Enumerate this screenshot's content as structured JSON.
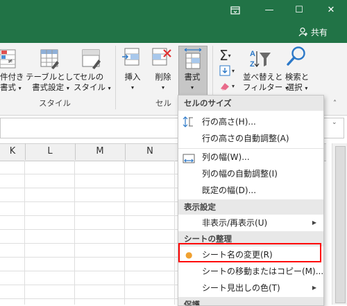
{
  "titlebar": {
    "minimize": "—",
    "maximize": "☐",
    "close": "✕",
    "share_label": "共有",
    "color": "#217346"
  },
  "ribbon": {
    "styles_group": {
      "cond_format_line1": "件付き",
      "cond_format_line2": "書式",
      "table_format_line1": "テーブルとして",
      "table_format_line2": "書式設定",
      "cell_style_line1": "セルの",
      "cell_style_line2": "スタイル",
      "group_label": "スタイル"
    },
    "cells_group": {
      "insert_label": "挿入",
      "delete_label": "削除",
      "format_label": "書式",
      "group_label": "セル"
    },
    "editing_group": {
      "sort_line1": "並べ替えと",
      "sort_line2": "フィルター",
      "find_line1": "検索と",
      "find_line2": "選択"
    }
  },
  "sheet": {
    "columns": [
      "K",
      "L",
      "M",
      "N"
    ]
  },
  "menu": {
    "sections": [
      {
        "header": "セルのサイズ",
        "items": [
          {
            "label": "行の高さ(H)...",
            "icon": "row-height-icon"
          },
          {
            "label": "行の高さの自動調整(A)",
            "icon": ""
          },
          {
            "label": "列の幅(W)...",
            "icon": "column-width-icon"
          },
          {
            "label": "列の幅の自動調整(I)",
            "icon": ""
          },
          {
            "label": "既定の幅(D)...",
            "icon": ""
          }
        ]
      },
      {
        "header": "表示設定",
        "items": [
          {
            "label": "非表示/再表示(U)",
            "icon": "",
            "submenu": true
          }
        ]
      },
      {
        "header": "シートの整理",
        "items": [
          {
            "label": "シート名の変更(R)",
            "icon": "bullet-icon",
            "highlighted": true
          },
          {
            "label": "シートの移動またはコピー(M)...",
            "icon": ""
          },
          {
            "label": "シート見出しの色(T)",
            "icon": "",
            "submenu": true
          }
        ]
      },
      {
        "header": "保護",
        "items": []
      }
    ],
    "highlight_color": "#ff0000",
    "bullet_color": "#f0a030"
  }
}
